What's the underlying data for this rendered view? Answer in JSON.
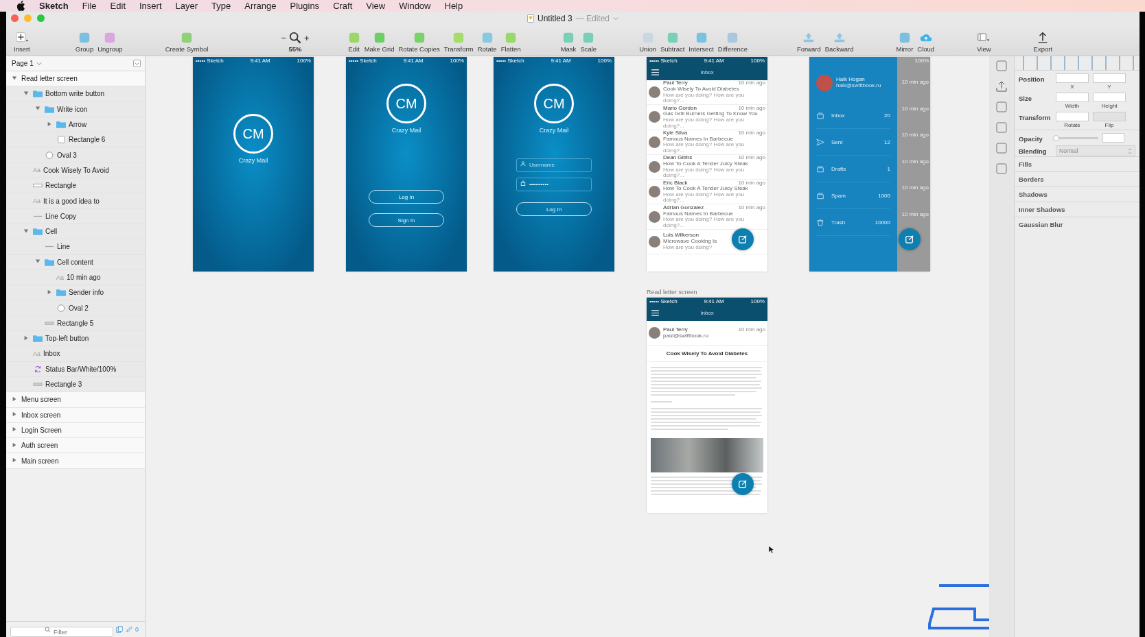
{
  "menubar": {
    "app": "Sketch",
    "items": [
      "File",
      "Edit",
      "Insert",
      "Layer",
      "Type",
      "Arrange",
      "Plugins",
      "Craft",
      "View",
      "Window",
      "Help"
    ]
  },
  "window": {
    "title": "Untitled 3",
    "subtitle": "— Edited"
  },
  "toolbar": [
    {
      "label": "Insert",
      "kind": "plus"
    },
    {
      "label": "Group",
      "kind": "tool"
    },
    {
      "label": "Ungroup",
      "kind": "tool"
    },
    {
      "label": "Create Symbol",
      "kind": "tool"
    },
    {
      "label": "55%",
      "kind": "zoom",
      "minus": "−",
      "plus": "+"
    },
    {
      "label": "Edit",
      "kind": "tool"
    },
    {
      "label": "Make Grid",
      "kind": "tool"
    },
    {
      "label": "Rotate Copies",
      "kind": "tool"
    },
    {
      "label": "Transform",
      "kind": "tool"
    },
    {
      "label": "Rotate",
      "kind": "tool"
    },
    {
      "label": "Flatten",
      "kind": "tool"
    },
    {
      "label": "Mask",
      "kind": "tool"
    },
    {
      "label": "Scale",
      "kind": "tool"
    },
    {
      "label": "Union",
      "kind": "tool"
    },
    {
      "label": "Subtract",
      "kind": "tool"
    },
    {
      "label": "Intersect",
      "kind": "tool"
    },
    {
      "label": "Difference",
      "kind": "tool"
    },
    {
      "label": "Forward",
      "kind": "arrow"
    },
    {
      "label": "Backward",
      "kind": "arrow"
    },
    {
      "label": "Mirror",
      "kind": "tool"
    },
    {
      "label": "Cloud",
      "kind": "cloud"
    },
    {
      "label": "View",
      "kind": "view"
    },
    {
      "label": "Export",
      "kind": "export"
    }
  ],
  "layers": {
    "page": "Page 1",
    "items": [
      {
        "label": "Read letter screen",
        "kind": "artboard",
        "expanded": true,
        "children": [
          {
            "label": "Bottom write button",
            "kind": "group",
            "expanded": true,
            "children": [
              {
                "label": "Write icon",
                "kind": "group",
                "expanded": true,
                "children": [
                  {
                    "label": "Arrow",
                    "kind": "group",
                    "expanded": false
                  },
                  {
                    "label": "Rectangle 6",
                    "kind": "square"
                  }
                ]
              },
              {
                "label": "Oval 3",
                "kind": "oval"
              }
            ]
          },
          {
            "label": "Cook Wisely To Avoid",
            "kind": "text",
            "glyph": "Aa"
          },
          {
            "label": "Rectangle",
            "kind": "rect"
          },
          {
            "label": "It is a good idea to",
            "kind": "text",
            "glyph": "Aa"
          },
          {
            "label": "Line Copy",
            "kind": "line"
          },
          {
            "label": "Cell",
            "kind": "group",
            "expanded": true,
            "children": [
              {
                "label": "Line",
                "kind": "line"
              },
              {
                "label": "Cell content",
                "kind": "group",
                "expanded": true,
                "children": [
                  {
                    "label": "10 min ago",
                    "kind": "text",
                    "glyph": "Aa"
                  },
                  {
                    "label": "Sender info",
                    "kind": "group",
                    "expanded": false
                  },
                  {
                    "label": "Oval 2",
                    "kind": "oval"
                  }
                ]
              },
              {
                "label": "Rectangle 5",
                "kind": "bar"
              }
            ]
          },
          {
            "label": "Top-left button",
            "kind": "group",
            "expanded": false
          },
          {
            "label": "Inbox",
            "kind": "text",
            "glyph": "Aa"
          },
          {
            "label": "Status Bar/White/100%",
            "kind": "symbol"
          },
          {
            "label": "Rectangle 3",
            "kind": "bar"
          }
        ]
      },
      {
        "label": "Menu screen",
        "kind": "artboard",
        "expanded": false
      },
      {
        "label": "Inbox screen",
        "kind": "artboard",
        "expanded": false
      },
      {
        "label": "Login Screen",
        "kind": "artboard",
        "expanded": false
      },
      {
        "label": "Auth screen",
        "kind": "artboard",
        "expanded": false
      },
      {
        "label": "Main screen",
        "kind": "artboard",
        "expanded": false
      }
    ],
    "filter": {
      "placeholder": "Filter"
    },
    "count": "0"
  },
  "splash": {
    "status_bar": {
      "carrier": "••••• Sketch",
      "time": "9:41 AM",
      "battery": "100%"
    },
    "logo": "CM",
    "name": "Crazy Mail"
  },
  "start": {
    "status_bar": {
      "carrier": "••••• Sketch",
      "time": "9:41 AM",
      "battery": "100%"
    },
    "logo": "CM",
    "name": "Crazy Mail",
    "buttons": [
      "Log In",
      "Sign In"
    ]
  },
  "login": {
    "status_bar": {
      "carrier": "••••• Sketch",
      "time": "9:41 AM",
      "battery": "100%"
    },
    "logo": "CM",
    "name": "Crazy Mail",
    "username": {
      "placeholder": "Username"
    },
    "password": {
      "value": "••••••••••"
    },
    "button": "Log In"
  },
  "inbox": {
    "status_bar": {
      "carrier": "••••• Sketch",
      "time": "9:41 AM",
      "battery": "100%"
    },
    "title": "Inbox",
    "messages": [
      {
        "sender": "Paul Terry",
        "subject": "Cook Wisely To Avoid Diabetes",
        "preview": "How are you doing? How are you doing?...",
        "time": "10 min ago"
      },
      {
        "sender": "Mario Gordon",
        "subject": "Gas Grill Burners Getting To Know You",
        "preview": "How are you doing? How are you doing?...",
        "time": "10 min ago"
      },
      {
        "sender": "Kyle Silva",
        "subject": "Famous Names In Barbecue",
        "preview": "How are you doing? How are you doing?...",
        "time": "10 min ago"
      },
      {
        "sender": "Dean Gibbs",
        "subject": "How To Cook A Tender Juicy Steak",
        "preview": "How are you doing? How are you doing?...",
        "time": "10 min ago"
      },
      {
        "sender": "Eric Black",
        "subject": "How To Cook A Tender Juicy Steak",
        "preview": "How are you doing? How are you doing?...",
        "time": "10 min ago"
      },
      {
        "sender": "Adrian Gonzalez",
        "subject": "Famous Names In Barbecue",
        "preview": "How are you doing? How are you doing?...",
        "time": "10 min ago"
      },
      {
        "sender": "Luis Wilkerson",
        "subject": "Microwave Cooking Is",
        "preview": "How are you doing?"
      }
    ]
  },
  "menu": {
    "user": "Halk Hogan",
    "email": "halk@swiftbook.ru",
    "battery": "100%",
    "items": [
      {
        "label": "Inbox",
        "count": "20",
        "kind": "tray"
      },
      {
        "label": "Sent",
        "count": "12",
        "kind": "plane"
      },
      {
        "label": "Drafts",
        "count": "1",
        "kind": "tray"
      },
      {
        "label": "Spam",
        "count": "1000",
        "kind": "tray"
      },
      {
        "label": "Trash",
        "count": "10000",
        "kind": "bin"
      }
    ],
    "peek_times": [
      "10 min ago",
      "10 min ago",
      "10 min ago",
      "10 min ago",
      "10 min ago",
      "10 min ago"
    ]
  },
  "letter": {
    "status_bar": {
      "carrier": "••••• Sketch",
      "time": "9:41 AM",
      "battery": "100%"
    },
    "label": "Read letter screen",
    "title": "Inbox",
    "sender": "Paul Terry",
    "email": "paul@swiftbook.ru",
    "time": "10 min ago",
    "subject": "Cook Wisely To Avoid Diabetes"
  },
  "inspector": {
    "position": {
      "label": "Position",
      "x": "X",
      "y": "Y"
    },
    "size": {
      "label": "Size",
      "w": "Width",
      "h": "Height"
    },
    "transform": {
      "label": "Transform",
      "rotate": "Rotate",
      "flip": "Flip"
    },
    "opacity": {
      "label": "Opacity",
      "level": 0
    },
    "blending": {
      "label": "Blending",
      "value": "Normal"
    },
    "sections": [
      "Fills",
      "Borders",
      "Shadows",
      "Inner Shadows",
      "Gaussian Blur"
    ]
  }
}
